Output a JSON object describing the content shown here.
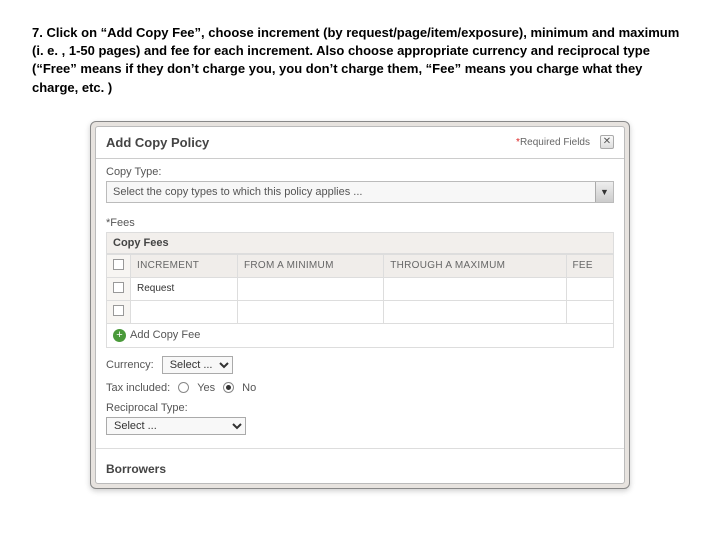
{
  "instruction": "7. Click on “Add Copy Fee”, choose increment (by request/page/item/exposure), minimum and maximum (i. e. , 1-50 pages) and fee for each increment.  Also choose appropriate currency and reciprocal type (“Free” means if they don’t charge you, you don’t charge them, “Fee” means you charge what they charge, etc. )",
  "dialog": {
    "title": "Add Copy Policy",
    "required_label": "Required Fields",
    "copy_type_label": "Copy Type:",
    "copy_type_placeholder": "Select the copy types to which this policy applies ...",
    "fees_label": "*Fees",
    "fees_section_title": "Copy Fees",
    "table": {
      "headers": [
        "",
        "INCREMENT",
        "FROM A MINIMUM",
        "THROUGH A MAXIMUM",
        "FEE"
      ],
      "row1_increment": "Request"
    },
    "add_fee_label": "Add Copy Fee",
    "currency_label": "Currency:",
    "currency_value": "Select ...",
    "tax_label": "Tax included:",
    "tax_yes": "Yes",
    "tax_no": "No",
    "reciprocal_label": "Reciprocal Type:",
    "reciprocal_value": "Select ...",
    "borrowers_label": "Borrowers"
  }
}
